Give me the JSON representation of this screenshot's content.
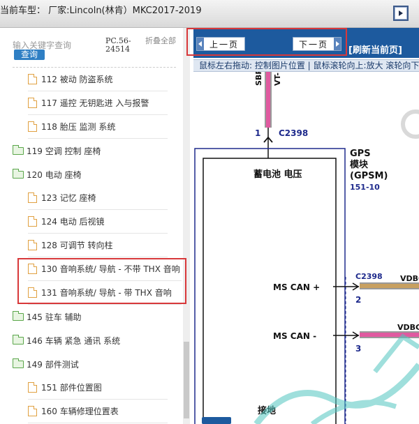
{
  "titlebar": {
    "title": "当前车型：  厂家:Lincoln(林肯）MKC2017-2019",
    "window_button_icon": "restore-icon"
  },
  "sidebar": {
    "search_placeholder": "输入关键字查询",
    "search_button": "查询",
    "pc_number": "PC.56-24514",
    "fold_all": "折叠全部",
    "items": [
      {
        "type": "leaf",
        "label": "112 被动 防盗系统"
      },
      {
        "type": "leaf",
        "label": "117 遥控 无钥匙进 入与报警"
      },
      {
        "type": "leaf",
        "label": "118 胎压 监测 系统"
      },
      {
        "type": "folder",
        "label": "119 空调 控制 座椅"
      },
      {
        "type": "folder",
        "label": "120 电动 座椅"
      },
      {
        "type": "leaf",
        "label": "123 记忆 座椅"
      },
      {
        "type": "leaf",
        "label": "124 电动 后视镜"
      },
      {
        "type": "leaf",
        "label": "128 可调节 转向柱"
      },
      {
        "type": "leaf",
        "label": "130 音响系统/ 导航 - 不带 THX 音响"
      },
      {
        "type": "leaf",
        "label": "131 音响系统/ 导航 - 带 THX 音响"
      },
      {
        "type": "folder",
        "label": "145 驻车 辅助"
      },
      {
        "type": "folder",
        "label": "146 车辆 紧急 通讯 系统"
      },
      {
        "type": "folder",
        "label": "149 部件测试"
      },
      {
        "type": "leaf",
        "label": "151 部件位置图"
      },
      {
        "type": "leaf",
        "label": "160 车辆修理位置表"
      }
    ]
  },
  "toolbar": {
    "prev_label": "上一页",
    "next_label": "下一页",
    "refresh_label": "[刷新当前页]"
  },
  "hint": "鼠标左右拖动: 控制图片位置 | 鼠标滚轮向上:放大   滚轮向下",
  "diagram": {
    "wire_top_labels": [
      "SBP",
      "VT-F"
    ],
    "pin1_number": "1",
    "connector_top": "C2398",
    "module_name_line1": "GPS",
    "module_name_line2": "模块",
    "module_name_line3": "(GPSM)",
    "module_ref": "151-10",
    "battery_voltage_label": "蓄电池 电压",
    "ms_can_plus_label": "MS CAN +",
    "ms_can_minus_label": "MS CAN -",
    "connector_right": "C2398",
    "pin2_number": "2",
    "pin3_number": "3",
    "wire_right_1": "VDBG",
    "wire_right_2": "VDBG",
    "ground_label": "接地"
  },
  "colors": {
    "nav_blue": "#1d5a9e",
    "highlight_red": "#d8383a",
    "module_blue": "#1e2a8c",
    "wire_pink": "#e05aa0",
    "wire_tan": "#c8a060"
  }
}
